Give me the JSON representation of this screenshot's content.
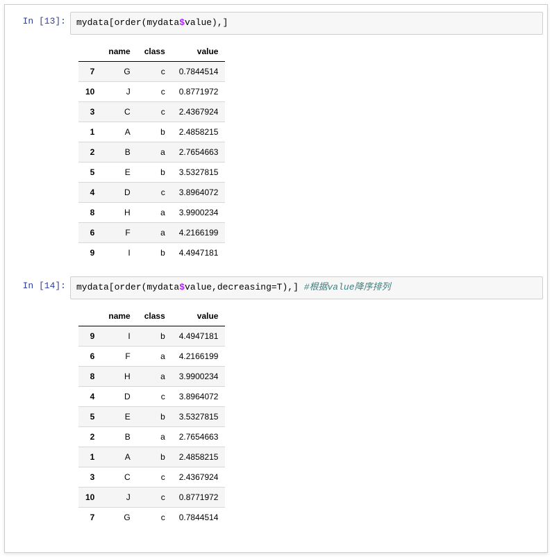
{
  "cell1": {
    "prompt": "In [13]:",
    "code_parts": {
      "p1": "mydata[order(mydata",
      "op": "$",
      "p2": "value),]"
    },
    "table": {
      "columns": [
        "name",
        "class",
        "value"
      ],
      "rows": [
        {
          "idx": "7",
          "name": "G",
          "class": "c",
          "value": "0.7844514"
        },
        {
          "idx": "10",
          "name": "J",
          "class": "c",
          "value": "0.8771972"
        },
        {
          "idx": "3",
          "name": "C",
          "class": "c",
          "value": "2.4367924"
        },
        {
          "idx": "1",
          "name": "A",
          "class": "b",
          "value": "2.4858215"
        },
        {
          "idx": "2",
          "name": "B",
          "class": "a",
          "value": "2.7654663"
        },
        {
          "idx": "5",
          "name": "E",
          "class": "b",
          "value": "3.5327815"
        },
        {
          "idx": "4",
          "name": "D",
          "class": "c",
          "value": "3.8964072"
        },
        {
          "idx": "8",
          "name": "H",
          "class": "a",
          "value": "3.9900234"
        },
        {
          "idx": "6",
          "name": "F",
          "class": "a",
          "value": "4.2166199"
        },
        {
          "idx": "9",
          "name": "I",
          "class": "b",
          "value": "4.4947181"
        }
      ]
    }
  },
  "cell2": {
    "prompt": "In [14]:",
    "code_parts": {
      "p1": "mydata[order(mydata",
      "op": "$",
      "p2": "value,decreasing=T),] ",
      "comment": "#根据value降序排列"
    },
    "table": {
      "columns": [
        "name",
        "class",
        "value"
      ],
      "rows": [
        {
          "idx": "9",
          "name": "I",
          "class": "b",
          "value": "4.4947181"
        },
        {
          "idx": "6",
          "name": "F",
          "class": "a",
          "value": "4.2166199"
        },
        {
          "idx": "8",
          "name": "H",
          "class": "a",
          "value": "3.9900234"
        },
        {
          "idx": "4",
          "name": "D",
          "class": "c",
          "value": "3.8964072"
        },
        {
          "idx": "5",
          "name": "E",
          "class": "b",
          "value": "3.5327815"
        },
        {
          "idx": "2",
          "name": "B",
          "class": "a",
          "value": "2.7654663"
        },
        {
          "idx": "1",
          "name": "A",
          "class": "b",
          "value": "2.4858215"
        },
        {
          "idx": "3",
          "name": "C",
          "class": "c",
          "value": "2.4367924"
        },
        {
          "idx": "10",
          "name": "J",
          "class": "c",
          "value": "0.8771972"
        },
        {
          "idx": "7",
          "name": "G",
          "class": "c",
          "value": "0.7844514"
        }
      ]
    }
  }
}
